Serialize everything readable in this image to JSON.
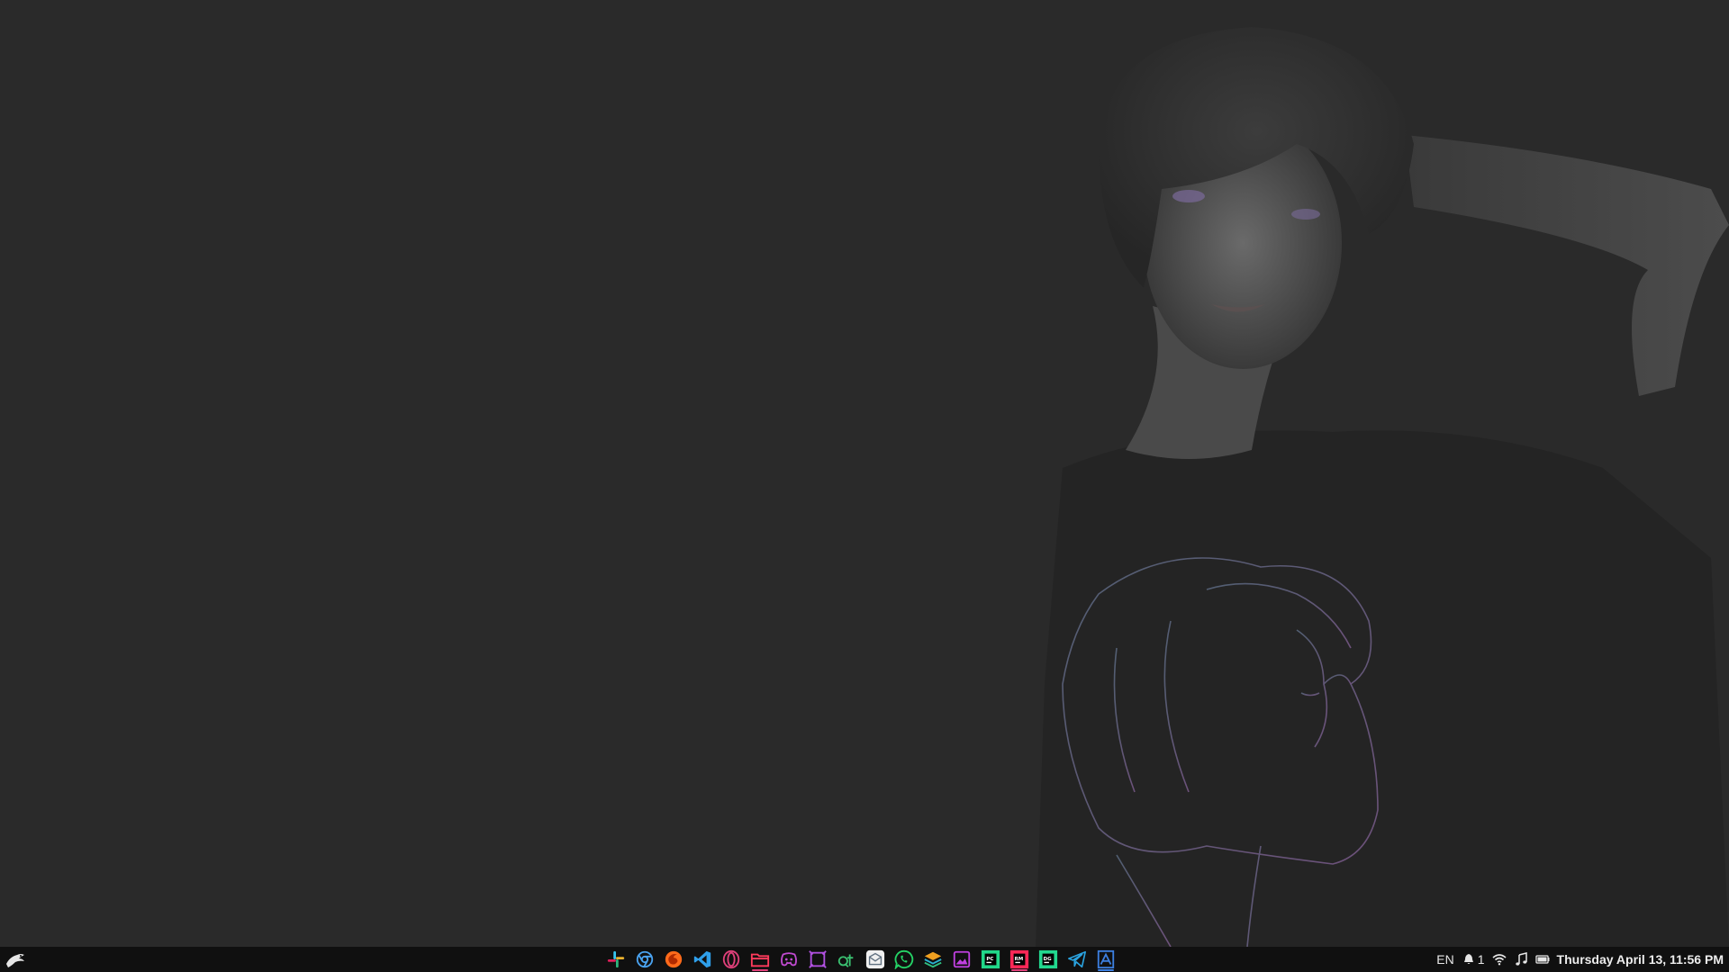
{
  "desktop": {
    "wallpaper": "anime-girl-wallpaper",
    "background_color": "#2a2a2a"
  },
  "taskbar": {
    "start_icon": "eagle-menu-icon",
    "dock_apps": [
      {
        "name": "slack",
        "icon": "slack-icon",
        "color": "#e01e5a",
        "active": false
      },
      {
        "name": "chrome",
        "icon": "chrome-icon",
        "color": "#4aa3f0",
        "active": false
      },
      {
        "name": "firefox",
        "icon": "firefox-icon",
        "color": "#ff6a1a",
        "active": false
      },
      {
        "name": "vscode",
        "icon": "vscode-icon",
        "color": "#2f9fea",
        "active": false
      },
      {
        "name": "opera",
        "icon": "opera-icon",
        "color": "#e0407a",
        "active": false
      },
      {
        "name": "files",
        "icon": "folder-icon",
        "color": "#ff3b5c",
        "active": true
      },
      {
        "name": "discord",
        "icon": "discord-icon",
        "color": "#c04ad0",
        "active": false
      },
      {
        "name": "qt-designer",
        "icon": "qt-designer-icon",
        "color": "#b050e0",
        "active": false
      },
      {
        "name": "qt-creator",
        "icon": "qt-creator-icon",
        "color": "#3ac070",
        "active": false
      },
      {
        "name": "mail",
        "icon": "mail-icon",
        "color": "#ffffff",
        "active": false
      },
      {
        "name": "whatsapp",
        "icon": "whatsapp-icon",
        "color": "#25d366",
        "active": false
      },
      {
        "name": "layers",
        "icon": "layers-icon",
        "color": "#f0a020",
        "active": false
      },
      {
        "name": "image-viewer",
        "icon": "image-viewer-icon",
        "color": "#c040e0",
        "active": false
      },
      {
        "name": "pycharm",
        "icon": "pycharm-icon",
        "color": "#21d789",
        "active": false
      },
      {
        "name": "rubymine",
        "icon": "rubymine-icon",
        "color": "#fe2857",
        "active": true
      },
      {
        "name": "datagrip",
        "icon": "datagrip-icon",
        "color": "#22d88f",
        "active": false
      },
      {
        "name": "telegram",
        "icon": "telegram-icon",
        "color": "#2aa3e0",
        "active": false
      },
      {
        "name": "document-viewer",
        "icon": "document-viewer-icon",
        "color": "#3c7fe0",
        "active": true
      }
    ]
  },
  "tray": {
    "keyboard_layout": "EN",
    "notification_count": "1",
    "notification_icon": "bell-icon",
    "wifi_icon": "wifi-icon",
    "music_icon": "music-note-icon",
    "battery_icon": "battery-icon",
    "clock": "Thursday April 13, 11:56 PM"
  }
}
